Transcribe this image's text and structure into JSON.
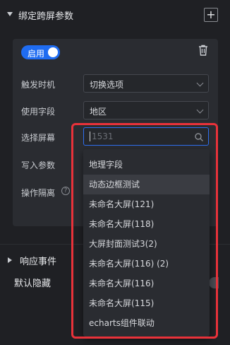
{
  "section": {
    "title": "绑定跨屏参数",
    "add_label": "+"
  },
  "card": {
    "toggle_label": "启用",
    "rows": [
      {
        "label": "触发时机",
        "value": "切换选项"
      },
      {
        "label": "使用字段",
        "value": "地区"
      },
      {
        "label": "选择屏幕",
        "placeholder": "1531"
      },
      {
        "label": "写入参数"
      },
      {
        "label": "操作隔离"
      }
    ],
    "help_glyph": "?"
  },
  "dropdown": {
    "items": [
      "地理字段",
      "动态边框测试",
      "未命名大屏(121)",
      "未命名大屏(118)",
      "大屏封面测试3(2)",
      "未命名大屏(116) (2)",
      "未命名大屏(116)",
      "未命名大屏(115)",
      "echarts组件联动"
    ],
    "hovered_index": 1
  },
  "events": {
    "title": "响应事件"
  },
  "default_hidden": {
    "label": "默认隐藏"
  },
  "colors": {
    "accent": "#1f6cf1",
    "highlight": "#e8323a",
    "background": "#1f2024",
    "panel": "#2a2c31"
  },
  "icons": [
    "caret-down-icon",
    "plus-icon",
    "trash-icon",
    "chevron-down-icon",
    "search-icon",
    "help-icon",
    "caret-right-icon"
  ]
}
